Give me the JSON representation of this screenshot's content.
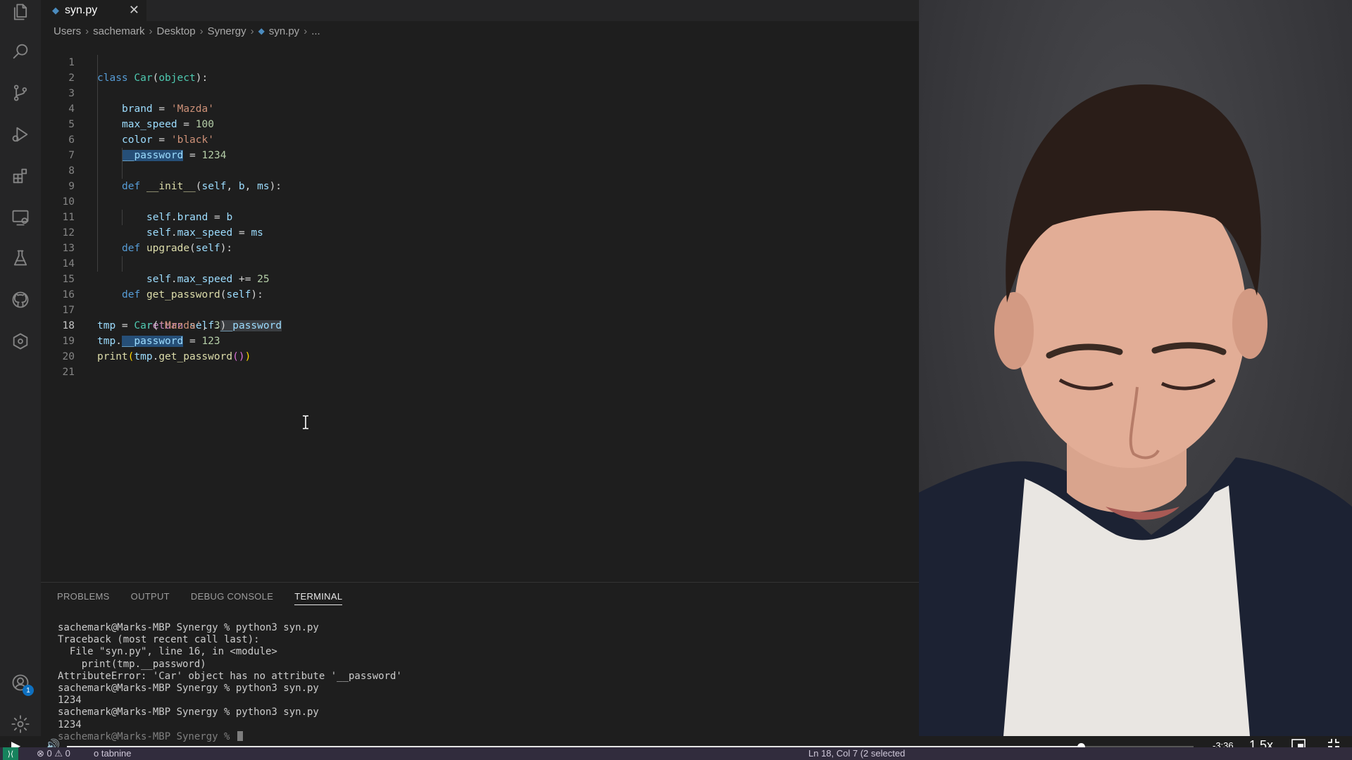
{
  "activity_bar": {
    "icons": [
      "files-icon",
      "search-icon",
      "source-control-icon",
      "run-debug-icon",
      "extensions-icon",
      "remote-explorer-icon",
      "testing-icon",
      "github-icon",
      "gitlens-icon",
      "account-icon",
      "settings-gear-icon"
    ],
    "account_badge": "1"
  },
  "tab": {
    "label": "syn.py",
    "close": "✕"
  },
  "breadcrumb": {
    "parts": [
      "Users",
      "sachemark",
      "Desktop",
      "Synergy"
    ],
    "file": "syn.py",
    "tail": "..."
  },
  "editor": {
    "line_numbers": [
      "1",
      "2",
      "3",
      "4",
      "5",
      "6",
      "7",
      "8",
      "9",
      "10",
      "11",
      "12",
      "13",
      "14",
      "15",
      "16",
      "17",
      "18",
      "19",
      "20",
      "21"
    ],
    "active_line": "18",
    "tokens": {
      "l1": [
        "class",
        "Car",
        "(",
        "object",
        "):"
      ],
      "l2": [
        "brand",
        " = ",
        "'Mazda'"
      ],
      "l3": [
        "max_speed",
        " = ",
        "100"
      ],
      "l4": [
        "color",
        " = ",
        "'black'"
      ],
      "l5": [
        "__password",
        " = ",
        "1234"
      ],
      "l7": [
        "def",
        "__init__",
        "(",
        "self",
        ", ",
        "b",
        ", ",
        "ms",
        "):"
      ],
      "l8": [
        "self",
        ".",
        "brand",
        " = ",
        "b"
      ],
      "l9": [
        "self",
        ".",
        "max_speed",
        " = ",
        "ms"
      ],
      "l11": [
        "def",
        "upgrade",
        "(",
        "self",
        "):"
      ],
      "l12": [
        "self",
        ".",
        "max_speed",
        " += ",
        "25"
      ],
      "l14": [
        "def",
        "get_password",
        "(",
        "self",
        "):"
      ],
      "l15": [
        "return",
        "self",
        ".",
        "__password"
      ],
      "l17": [
        "tmp",
        " = ",
        "Car",
        "(",
        "'Mazda'",
        ", ",
        "3",
        ")"
      ],
      "l18": [
        "tmp",
        ".",
        "__password",
        " = ",
        "123"
      ],
      "l19": [
        "print",
        "(",
        "tmp",
        ".",
        "get_password",
        "()",
        ")"
      ]
    }
  },
  "panel": {
    "tabs": [
      "PROBLEMS",
      "OUTPUT",
      "DEBUG CONSOLE",
      "TERMINAL"
    ],
    "active_tab": "TERMINAL",
    "terminal_lines": [
      "sachemark@Marks-MBP Synergy % python3 syn.py",
      "Traceback (most recent call last):",
      "  File \"syn.py\", line 16, in <module>",
      "    print(tmp.__password)",
      "AttributeError: 'Car' object has no attribute '__password'",
      "sachemark@Marks-MBP Synergy % python3 syn.py",
      "1234",
      "sachemark@Marks-MBP Synergy % python3 syn.py",
      "1234",
      "sachemark@Marks-MBP Synergy % "
    ]
  },
  "status_bar": {
    "errors": "0",
    "warnings": "0",
    "tabnine": "tabnine",
    "position": "Ln 18, Col 7 (2 selected"
  },
  "video": {
    "time_remaining": "-3:36",
    "speed": "1.5x",
    "progress": 0.9
  }
}
